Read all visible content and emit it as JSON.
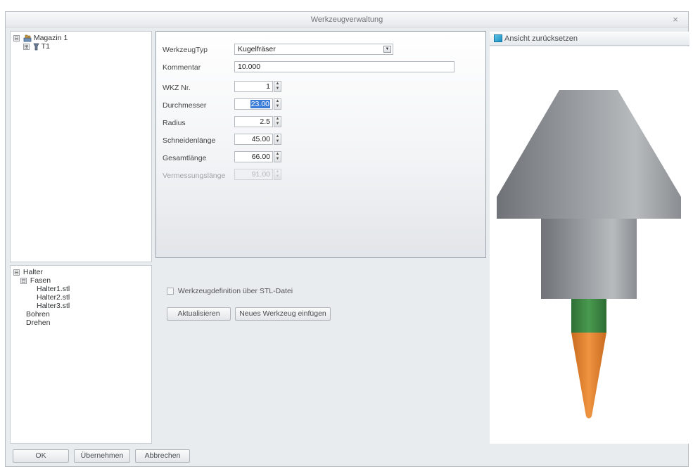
{
  "window": {
    "title": "Werkzeugverwaltung",
    "close_symbol": "×"
  },
  "magazine_tree": {
    "root": {
      "expander": "⊟",
      "label": "Magazin 1"
    },
    "child": {
      "expander": "⊞",
      "label": "T1"
    }
  },
  "holder_tree": {
    "root": {
      "expander": "⊟",
      "label": "Halter"
    },
    "items": [
      {
        "expander": "⊟",
        "label": "Fasen"
      },
      {
        "label": "Halter1.stl"
      },
      {
        "label": "Halter2.stl"
      },
      {
        "label": "Halter3.stl"
      },
      {
        "label": "Bohren"
      },
      {
        "label": "Drehen"
      }
    ]
  },
  "form": {
    "werkzeugtyp": {
      "label": "WerkzeugTyp",
      "value": "Kugelfräser"
    },
    "kommentar": {
      "label": "Kommentar",
      "value": "10.000"
    },
    "wkz_nr": {
      "label": "WKZ Nr.",
      "value": "1"
    },
    "durchmesser": {
      "label": "Durchmesser",
      "value": "23.00"
    },
    "radius": {
      "label": "Radius",
      "value": "2.5"
    },
    "schneidenlaenge": {
      "label": "Schneidenlänge",
      "value": "45.00"
    },
    "gesamtlaenge": {
      "label": "Gesamtlänge",
      "value": "66.00"
    },
    "vermessungslaenge": {
      "label": "Vermessungslänge",
      "value": "91.00"
    },
    "spin_up": "▲",
    "spin_down": "▼",
    "dropdown_arrow": "▼"
  },
  "stl_checkbox": {
    "label": "Werkzeugdefinition über STL-Datei",
    "checked": false
  },
  "buttons": {
    "aktualisieren": "Aktualisieren",
    "neues_werkzeug": "Neues Werkzeug einfügen",
    "ok": "OK",
    "uebernehmen": "Übernehmen",
    "abbrechen": "Abbrechen"
  },
  "viewer": {
    "reset_label": "Ansicht zurücksetzen"
  },
  "colors": {
    "holder_gray": "#8e9296",
    "shank_green": "#3f8a45",
    "cutter_orange": "#e0802c",
    "selection_blue": "#3b7cd6"
  }
}
